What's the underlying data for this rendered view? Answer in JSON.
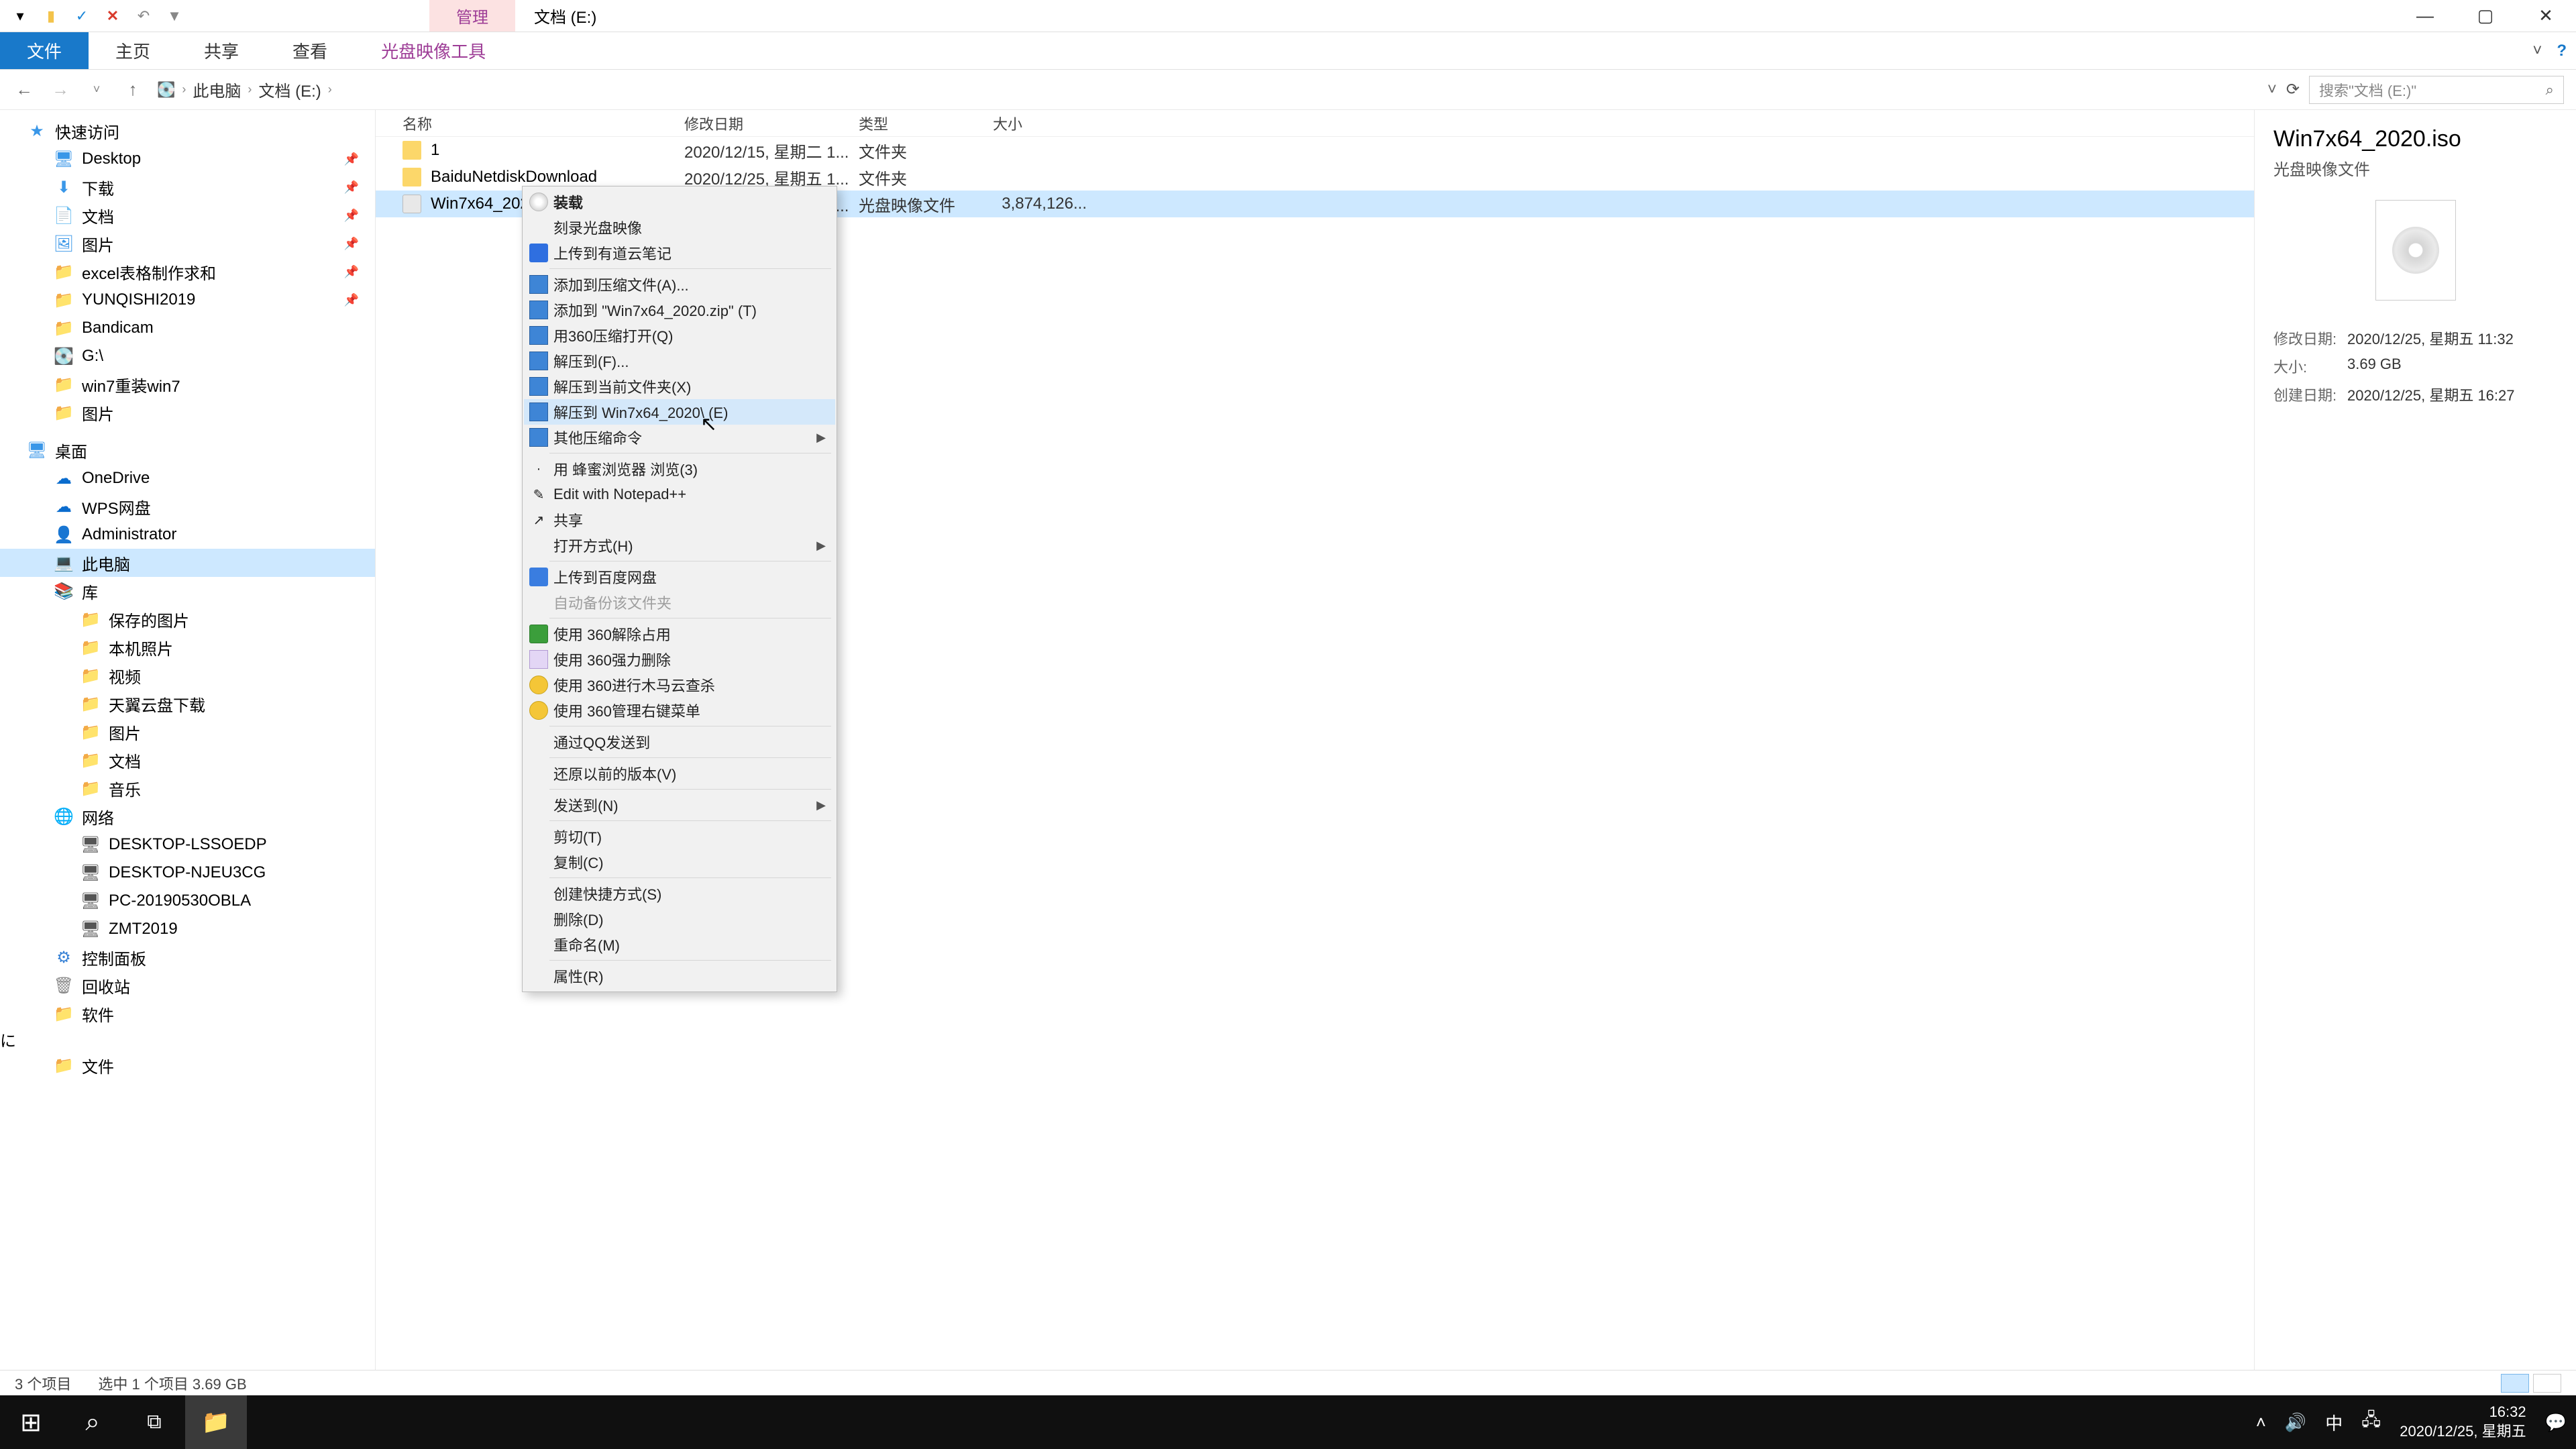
{
  "title_tab_active": "管理",
  "title_text": "文档 (E:)",
  "ribbon": {
    "file": "文件",
    "home": "主页",
    "share": "共享",
    "view": "查看",
    "tool": "光盘映像工具"
  },
  "nav": {
    "pc": "此电脑",
    "loc": "文档 (E:)"
  },
  "search_placeholder": "搜索\"文档 (E:)\"",
  "columns": {
    "name": "名称",
    "date": "修改日期",
    "type": "类型",
    "size": "大小"
  },
  "rows": [
    {
      "name": "1",
      "date": "2020/12/15, 星期二 1...",
      "type": "文件夹",
      "size": ""
    },
    {
      "name": "BaiduNetdiskDownload",
      "date": "2020/12/25, 星期五 1...",
      "type": "文件夹",
      "size": ""
    },
    {
      "name": "Win7x64_2020.iso",
      "date": "2020/12/25, 星期五 1...",
      "type": "光盘映像文件",
      "size": "3,874,126..."
    }
  ],
  "tree": {
    "quick": "快速访问",
    "items1": [
      "Desktop",
      "下载",
      "文档",
      "图片",
      "excel表格制作求和",
      "YUNQISHI2019",
      "Bandicam",
      "G:\\",
      "win7重装win7",
      "图片"
    ],
    "desktop": "桌面",
    "items2": [
      "OneDrive",
      "WPS网盘",
      "Administrator",
      "此电脑",
      "库"
    ],
    "lib": [
      "保存的图片",
      "本机照片",
      "视频",
      "天翼云盘下载",
      "图片",
      "文档",
      "音乐"
    ],
    "net": "网络",
    "netitems": [
      "DESKTOP-LSSOEDP",
      "DESKTOP-NJEU3CG",
      "PC-20190530OBLA",
      "ZMT2019"
    ],
    "misc": [
      "控制面板",
      "回收站",
      "软件",
      "文件"
    ]
  },
  "ctx": [
    {
      "t": "装载",
      "bold": true,
      "icon": "disc"
    },
    {
      "t": "刻录光盘映像"
    },
    {
      "t": "上传到有道云笔记",
      "icon": "note"
    },
    {
      "sep": true
    },
    {
      "t": "添加到压缩文件(A)...",
      "icon": "zip"
    },
    {
      "t": "添加到 \"Win7x64_2020.zip\" (T)",
      "icon": "zip"
    },
    {
      "t": "用360压缩打开(Q)",
      "icon": "zip"
    },
    {
      "t": "解压到(F)...",
      "icon": "zip"
    },
    {
      "t": "解压到当前文件夹(X)",
      "icon": "zip"
    },
    {
      "t": "解压到 Win7x64_2020\\ (E)",
      "icon": "zip",
      "hover": true
    },
    {
      "t": "其他压缩命令",
      "icon": "zip",
      "arrow": true
    },
    {
      "sep": true
    },
    {
      "t": "用 蜂蜜浏览器 浏览(3)",
      "icon": "dot"
    },
    {
      "t": "Edit with Notepad++",
      "icon": "npp"
    },
    {
      "t": "共享",
      "icon": "share"
    },
    {
      "t": "打开方式(H)",
      "arrow": true
    },
    {
      "sep": true
    },
    {
      "t": "上传到百度网盘",
      "icon": "bd"
    },
    {
      "t": "自动备份该文件夹",
      "disabled": true
    },
    {
      "sep": true
    },
    {
      "t": "使用 360解除占用",
      "icon": "360"
    },
    {
      "t": "使用 360强力删除",
      "icon": "trash"
    },
    {
      "t": "使用 360进行木马云查杀",
      "icon": "360y"
    },
    {
      "t": "使用 360管理右键菜单",
      "icon": "360y"
    },
    {
      "sep": true
    },
    {
      "t": "通过QQ发送到"
    },
    {
      "sep": true
    },
    {
      "t": "还原以前的版本(V)"
    },
    {
      "sep": true
    },
    {
      "t": "发送到(N)",
      "arrow": true
    },
    {
      "sep": true
    },
    {
      "t": "剪切(T)"
    },
    {
      "t": "复制(C)"
    },
    {
      "sep": true
    },
    {
      "t": "创建快捷方式(S)"
    },
    {
      "t": "删除(D)"
    },
    {
      "t": "重命名(M)"
    },
    {
      "sep": true
    },
    {
      "t": "属性(R)"
    }
  ],
  "details": {
    "title": "Win7x64_2020.iso",
    "sub": "光盘映像文件",
    "mod_label": "修改日期:",
    "mod": "2020/12/25, 星期五 11:32",
    "size_label": "大小:",
    "size": "3.69 GB",
    "create_label": "创建日期:",
    "create": "2020/12/25, 星期五 16:27"
  },
  "status": {
    "count": "3 个项目",
    "sel": "选中 1 个项目  3.69 GB"
  },
  "tray": {
    "time": "16:32",
    "date": "2020/12/25, 星期五",
    "ime": "中"
  }
}
